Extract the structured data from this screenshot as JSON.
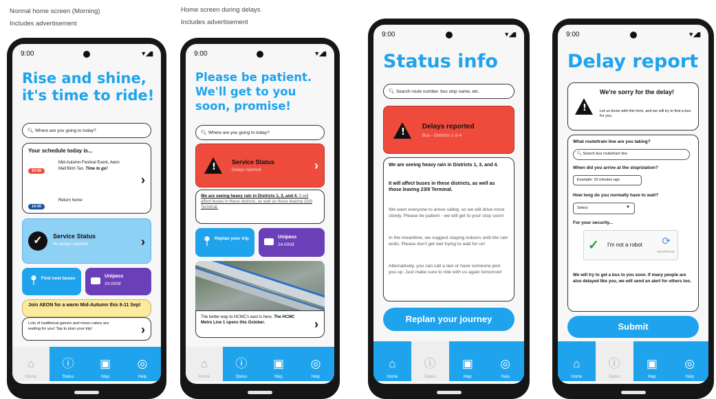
{
  "captions": {
    "phone1_line1": "Normal home screen (Morning)",
    "phone1_line2": "Includes advertisement",
    "phone2_line1": "Home screen during delays",
    "phone2_line2": "Includes advertisement"
  },
  "status_time": "9:00",
  "status_icons": "▼◢▮",
  "search_placeholder_home": "Where are you going to today?",
  "search_placeholder_status": "Search route number, bus stop name, etc.",
  "search_placeholder_route": "Search bus route/tram line",
  "phone1": {
    "headline": "Rise and shine, it's time to ride!",
    "schedule_title": "Your schedule today is...",
    "event1_time": "10:55",
    "event1_text": "Mid-Autumn Festival Event, Aeon Mall Binh Tan.",
    "event1_emph": "Time to go!",
    "event2_time": "14:00",
    "event2_text": "Return home",
    "service_title": "Service Status",
    "service_sub": "No delays reported.",
    "find_label": "Find next buses",
    "unipass_label": "Unipass",
    "unipass_value": "24.000đ",
    "ad_title": "Join AEON for a warm Mid-Autumn this 6-11 Sep!",
    "ad_body": "Lots of traditional games and moon cakes are waiting for you! Tap to plan your trip!"
  },
  "phone2": {
    "headline": "Please be patient. We'll get to you soon, promise!",
    "status_title": "Service Status",
    "status_sub": "Delays reported",
    "msg_bold": "We are seeing heavy rain in Districts 1, 3, and 4.",
    "msg_rest": "It will affect buses in these districts, as well as those leaving 23/9 Terminal.",
    "replan_label": "Replan your trip",
    "unipass_label": "Unipass",
    "unipass_value": "24.000đ",
    "metro_text": "The better way to HCMC's east is here.",
    "metro_bold": "The HCMC Metro Line 1 opens this October."
  },
  "phone3": {
    "headline": "Status info",
    "alert_title": "Delays reported",
    "alert_sub": "Bus - Districts 1-3-4",
    "p1": "We are seeing heavy rain in Districts 1, 3, and 4.",
    "p2": "It will affect buses in these districts, as well as those leaving 23/9 Terminal.",
    "p3": "We want everyone to arrive safely, so we will drive more slowly. Please be patient - we will get to your stop soon!",
    "p4": "In the meantime, we suggest staying indoors until the rain ends. Please don't get wet trying to wait for us!",
    "p5": "Alternatively, you can call a taxi or have someone pick you up. Just make sure to ride with us again tomorrow!",
    "button": "Replan your journey"
  },
  "phone4": {
    "headline": "Delay report",
    "sorry_title": "We're sorry for the delay!",
    "sorry_body": "Let us know with this form, and we will try to find a bus for you.",
    "q_route": "What route/train line are you taking?",
    "q_arrive": "When did you arrive at the stop/station?",
    "arrive_placeholder": "Example: 10 minutes ago",
    "q_wait": "How long do you normally have to wait?",
    "select_value": "Select",
    "security_label": "For your security...",
    "captcha_label": "I'm not a robot",
    "captcha_brand": "reCAPTCHA",
    "closing": "We will try to get a bus to you soon. If many people are also delayed like you, we will send an alert for others too.",
    "submit": "Submit"
  },
  "tabs": [
    "Home",
    "Status",
    "Map",
    "Help"
  ],
  "colors": {
    "blue": "#1ea3ec",
    "red": "#ef4b3c",
    "purple": "#6a3fb8",
    "yellow": "#fbeaa0",
    "light_blue": "#8fd0f5"
  }
}
